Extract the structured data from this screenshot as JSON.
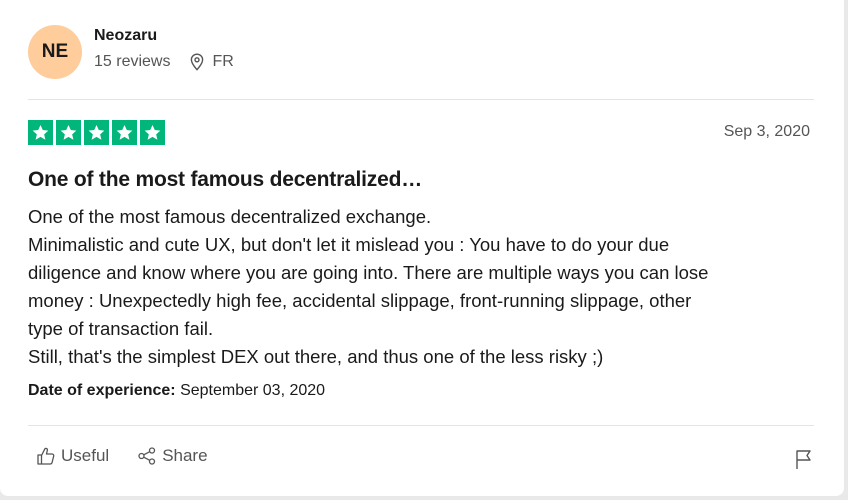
{
  "reviewer": {
    "initials": "NE",
    "name": "Neozaru",
    "reviews": "15 reviews",
    "country": "FR",
    "avatar_color": "#ffcc9c"
  },
  "review": {
    "rating": 5,
    "star_color": "#00b67a",
    "date": "Sep 3, 2020",
    "title": "One of the most famous decentralized…",
    "lines": [
      "One of the most famous decentralized exchange.",
      "Minimalistic and cute UX, but don't let it mislead you : You have to do your due",
      "diligence and know where you are going into. There are multiple ways you can lose",
      "money : Unexpectedly high fee, accidental slippage, front-running slippage, other",
      "type of transaction fail.",
      "Still, that's the simplest DEX out there, and thus one of the less risky ;)"
    ],
    "experience_label": "Date of experience:",
    "experience_date": "September 03, 2020"
  },
  "actions": {
    "useful_label": "Useful",
    "share_label": "Share",
    "useful_icon": "thumbs-up-icon",
    "share_icon": "share-icon",
    "flag_icon": "flag-icon"
  }
}
